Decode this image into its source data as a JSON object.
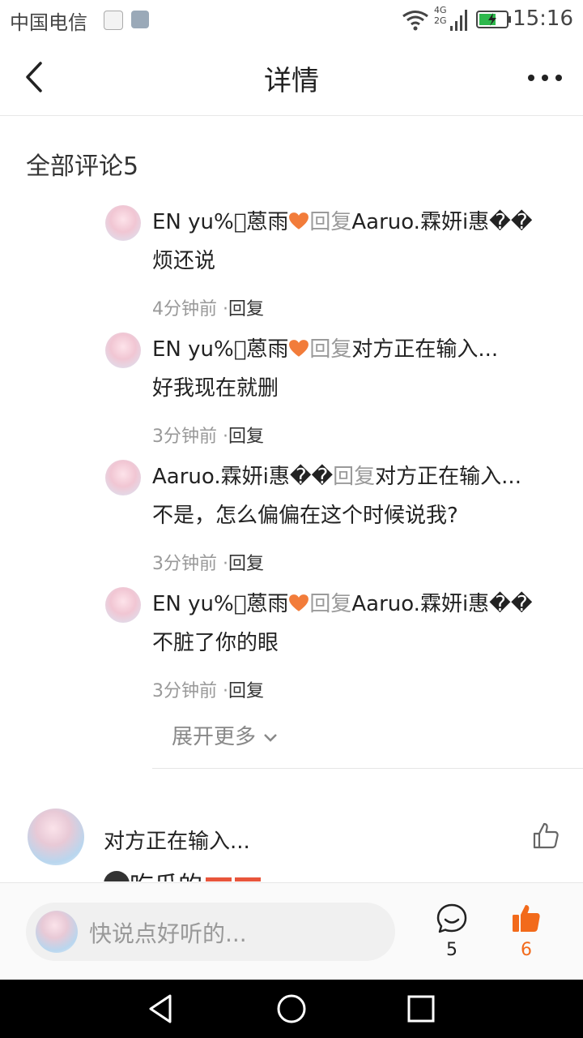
{
  "status_bar": {
    "carrier": "中国电信",
    "network": "4G 2G",
    "time": "15:16"
  },
  "nav": {
    "title": "详情"
  },
  "section": {
    "title": "全部评论5"
  },
  "replies": [
    {
      "author": "EN  yu%\u0000蒽雨",
      "reply_word": "回复",
      "target": "Aaruo.霖妍i惠��",
      "text": "烦还说",
      "time": "4分钟前 ·",
      "reply_btn": "回复",
      "heart": true
    },
    {
      "author": "EN  yu%\u0000蒽雨",
      "reply_word": "回复",
      "target": "对方正在输入...",
      "text": "好我现在就删",
      "time": "3分钟前 ·",
      "reply_btn": "回复",
      "heart": true
    },
    {
      "author": "Aaruo.霖妍i惠��",
      "reply_word": "回复",
      "target": "对方正在输入...",
      "text": "不是，怎么偏偏在这个时候说我?",
      "time": "3分钟前 ·",
      "reply_btn": "回复",
      "heart": false
    },
    {
      "author": "EN  yu%\u0000蒽雨",
      "reply_word": "回复",
      "target": "Aaruo.霖妍i惠��",
      "text": "不脏了你的眼",
      "time": "3分钟前 ·",
      "reply_btn": "回复",
      "heart": true
    }
  ],
  "expand_more": "展开更多",
  "comment": {
    "name": "对方正在输入...",
    "text": "吃瓜的"
  },
  "bottom_bar": {
    "placeholder": "快说点好听的...",
    "comment_count": "5",
    "like_count": "6"
  },
  "colors": {
    "accent": "#f26a1b",
    "heart": "#f27c3a"
  }
}
